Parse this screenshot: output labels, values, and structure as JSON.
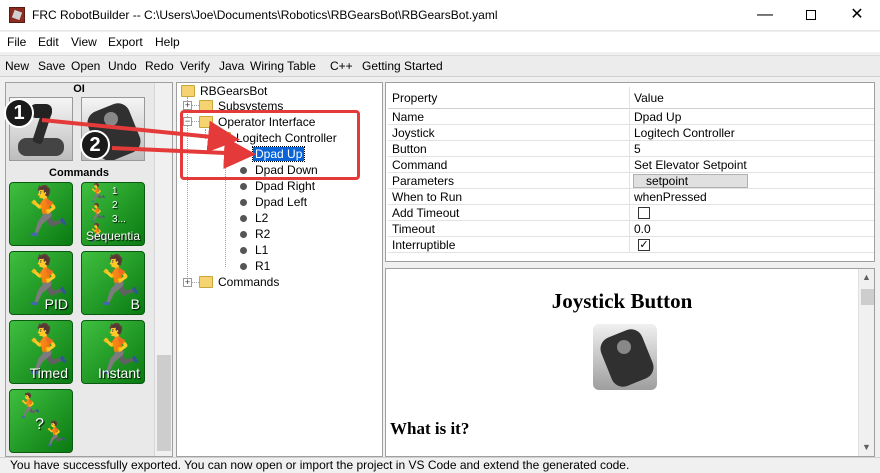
{
  "window": {
    "title": "FRC RobotBuilder -- C:\\Users\\Joe\\Documents\\Robotics\\RBGearsBot\\RBGearsBot.yaml",
    "minimize_glyph": "—",
    "close_glyph": "✕"
  },
  "menu": [
    "File",
    "Edit",
    "View",
    "Export",
    "Help"
  ],
  "toolbar": [
    "New",
    "Save",
    "Open",
    "Undo",
    "Redo",
    "Verify",
    "Java",
    "Wiring Table",
    "C++",
    "Getting Started"
  ],
  "palette": {
    "oi_label": "OI",
    "commands_label": "Commands",
    "tiles": {
      "sequential_caption": "Sequentia",
      "seq_nums": [
        "1",
        "2",
        "3..."
      ],
      "pid_caption": "PID",
      "b_caption": "B",
      "timed_caption": "Timed",
      "instant_caption": "Instant",
      "conditional_mark": "?"
    }
  },
  "tree": {
    "root": "RBGearsBot",
    "subsystems": "Subsystems",
    "operator_interface": "Operator Interface",
    "controller": "Logitech Controller",
    "buttons": [
      "Dpad Up",
      "Dpad Down",
      "Dpad Right",
      "Dpad Left",
      "L2",
      "R2",
      "L1",
      "R1"
    ],
    "commands": "Commands"
  },
  "properties": {
    "header": {
      "property": "Property",
      "value": "Value"
    },
    "rows": [
      {
        "key": "Name",
        "value": "Dpad Up"
      },
      {
        "key": "Joystick",
        "value": "Logitech Controller"
      },
      {
        "key": "Button",
        "value": "5"
      },
      {
        "key": "Command",
        "value": "Set Elevator Setpoint"
      },
      {
        "key": "Parameters",
        "value": "setpoint"
      },
      {
        "key": "When to Run",
        "value": "whenPressed"
      },
      {
        "key": "Add Timeout",
        "value": ""
      },
      {
        "key": "Timeout",
        "value": "0.0"
      },
      {
        "key": "Interruptible",
        "value": ""
      }
    ],
    "add_timeout_checked": false,
    "interruptible_checked": true,
    "check_glyph": "✓"
  },
  "help": {
    "title": "Joystick Button",
    "subtitle": "What is it?"
  },
  "statusbar": "You have successfully exported. You can now open or import the project in VS Code and extend the generated code.",
  "annotations": {
    "callout1": "1",
    "callout2": "2",
    "color": "#e43a3a"
  }
}
